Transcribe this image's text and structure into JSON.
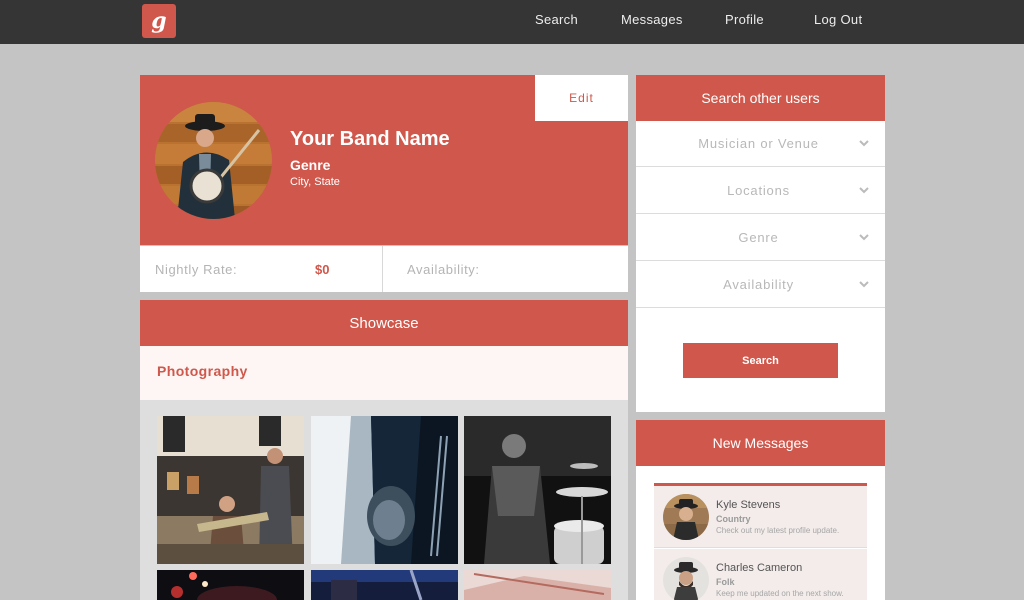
{
  "app": {
    "logo_letter": "g"
  },
  "nav": {
    "search": "Search",
    "messages": "Messages",
    "profile": "Profile",
    "logout": "Log Out"
  },
  "profile": {
    "edit_label": "Edit",
    "band_name": "Your Band Name",
    "genre": "Genre",
    "location": "City, State",
    "nightly_rate_label": "Nightly Rate:",
    "nightly_rate_value": "$0",
    "availability_label": "Availability:"
  },
  "showcase": {
    "title": "Showcase",
    "section_title": "Photography"
  },
  "search_panel": {
    "title": "Search other users",
    "filters": [
      "Musician or Venue",
      "Locations",
      "Genre",
      "Availability"
    ],
    "button_label": "Search"
  },
  "messages": {
    "title": "New Messages",
    "items": [
      {
        "name": "Kyle Stevens",
        "genre": "Country",
        "text": "Check out my latest profile update."
      },
      {
        "name": "Charles Cameron",
        "genre": "Folk",
        "text": "Keep me updated on the next show."
      }
    ]
  },
  "colors": {
    "accent": "#cf574b",
    "nav_bg": "#353535",
    "page_bg": "#c4c4c4"
  }
}
